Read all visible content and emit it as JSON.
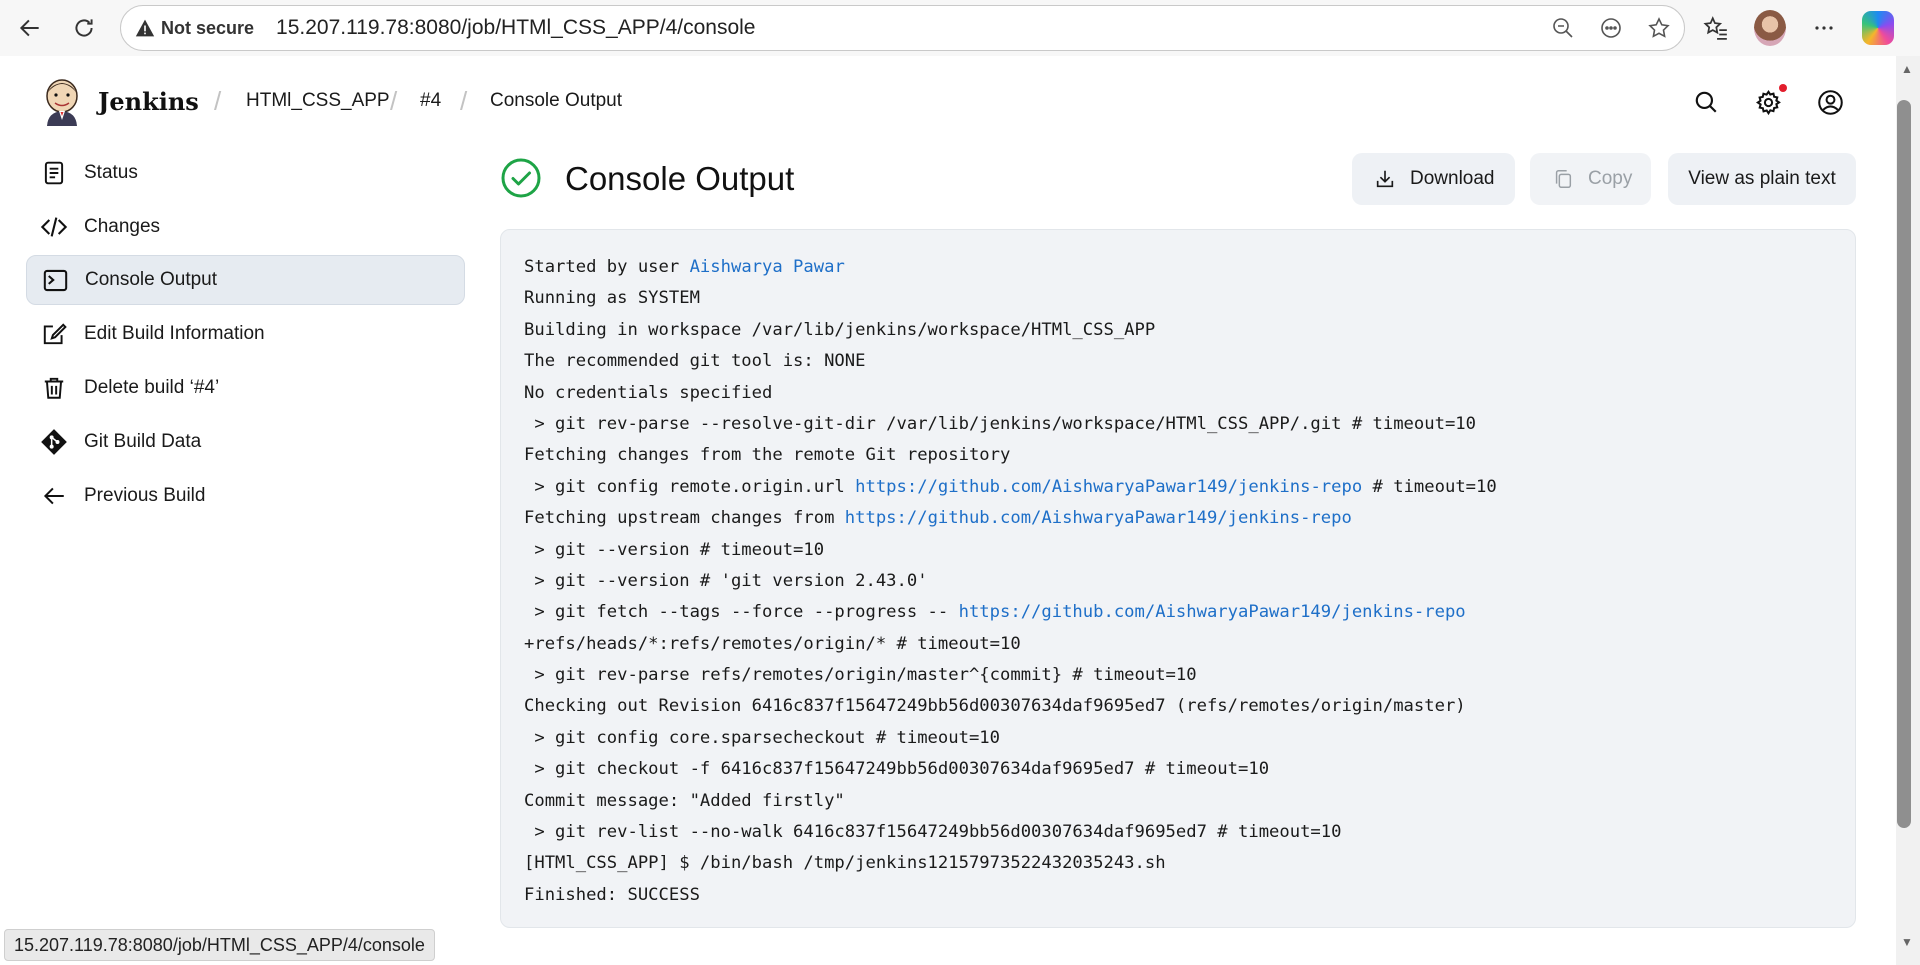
{
  "browser": {
    "not_secure": "Not secure",
    "url": "15.207.119.78:8080/job/HTMl_CSS_APP/4/console"
  },
  "header": {
    "brand": "Jenkins",
    "breadcrumbs": [
      "HTMl_CSS_APP",
      "#4",
      "Console Output"
    ]
  },
  "sidebar": {
    "items": [
      {
        "label": "Status",
        "icon": "document-icon"
      },
      {
        "label": "Changes",
        "icon": "code-icon"
      },
      {
        "label": "Console Output",
        "icon": "terminal-icon",
        "active": true
      },
      {
        "label": "Edit Build Information",
        "icon": "edit-icon"
      },
      {
        "label": "Delete build ‘#4’",
        "icon": "trash-icon"
      },
      {
        "label": "Git Build Data",
        "icon": "git-icon"
      },
      {
        "label": "Previous Build",
        "icon": "arrow-left-icon"
      }
    ]
  },
  "main": {
    "title": "Console Output",
    "buttons": {
      "download": "Download",
      "copy": "Copy",
      "plain_text": "View as plain text"
    }
  },
  "console": {
    "line1_prefix": "Started by user ",
    "line1_user": "Aishwarya Pawar",
    "line2": "Running as SYSTEM",
    "line3": "Building in workspace /var/lib/jenkins/workspace/HTMl_CSS_APP",
    "line4": "The recommended git tool is: NONE",
    "line5": "No credentials specified",
    "line6": " > git rev-parse --resolve-git-dir /var/lib/jenkins/workspace/HTMl_CSS_APP/.git # timeout=10",
    "line7": "Fetching changes from the remote Git repository",
    "line8_prefix": " > git config remote.origin.url ",
    "line8_link": "https://github.com/AishwaryaPawar149/jenkins-repo",
    "line8_suffix": " # timeout=10",
    "line9_prefix": "Fetching upstream changes from ",
    "line9_link": "https://github.com/AishwaryaPawar149/jenkins-repo",
    "line10": " > git --version # timeout=10",
    "line11": " > git --version # 'git version 2.43.0'",
    "line12_prefix": " > git fetch --tags --force --progress -- ",
    "line12_link": "https://github.com/AishwaryaPawar149/jenkins-repo",
    "line13": "+refs/heads/*:refs/remotes/origin/* # timeout=10",
    "line14": " > git rev-parse refs/remotes/origin/master^{commit} # timeout=10",
    "line15": "Checking out Revision 6416c837f15647249bb56d00307634daf9695ed7 (refs/remotes/origin/master)",
    "line16": " > git config core.sparsecheckout # timeout=10",
    "line17": " > git checkout -f 6416c837f15647249bb56d00307634daf9695ed7 # timeout=10",
    "line18": "Commit message: \"Added firstly\"",
    "line19": " > git rev-list --no-walk 6416c837f15647249bb56d00307634daf9695ed7 # timeout=10",
    "line20": "[HTMl_CSS_APP] $ /bin/bash /tmp/jenkins12157973522432035243.sh",
    "line21": "Finished: SUCCESS"
  },
  "status_bar": "15.207.119.78:8080/job/HTMl_CSS_APP/4/console",
  "colors": {
    "success": "#1ea446",
    "link": "#1e6fc8",
    "notification": "#e21d2c"
  }
}
